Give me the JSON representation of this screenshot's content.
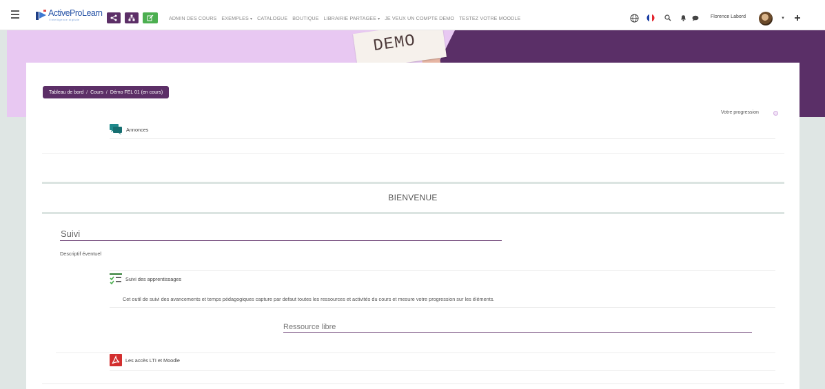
{
  "navbar": {
    "logo_text": "ActiveProLearn",
    "logo_tagline": "l'intelligence digitale",
    "links": [
      {
        "label": "ADMIN DES COURS",
        "dropdown": false
      },
      {
        "label": "EXEMPLES",
        "dropdown": true
      },
      {
        "label": "CATALOGUE",
        "dropdown": false
      },
      {
        "label": "BOUTIQUE",
        "dropdown": false
      },
      {
        "label": "LIBRAIRIE PARTAGEE",
        "dropdown": true
      },
      {
        "label": "JE VEUX UN COMPTE DEMO",
        "dropdown": false
      },
      {
        "label": "TESTEZ VOTRE MOODLE",
        "dropdown": false
      }
    ],
    "user_name": "Florence Labord",
    "quick_buttons": [
      "share-icon",
      "sitemap-icon",
      "edit-icon"
    ],
    "right_icons": [
      "globe-icon",
      "french-flag-icon",
      "search-icon",
      "bell-icon",
      "chat-icon",
      "plus-icon"
    ]
  },
  "banner": {
    "demo_text": "DEMO"
  },
  "breadcrumb": {
    "items": [
      "Tableau de bord",
      "Cours",
      "Démo FEL 01 (en cours)"
    ],
    "separator": "/"
  },
  "progress": {
    "label": "Votre progression"
  },
  "announcements": {
    "label": "Annonces",
    "icon": "forum-icon"
  },
  "section": {
    "title": "BIENVENUE"
  },
  "suivi": {
    "title": "Suivi",
    "description": "Descriptif éventuel",
    "activity_label": "Suivi des apprentissages",
    "activity_icon": "checklist-icon",
    "activity_description": "Cet outil de suivi des avancements et temps pédagogiques capture par defaut toutes les ressources et activités du cours et mesure votre progression sur les éléments."
  },
  "ressource": {
    "title": "Ressource libre",
    "file_label": "Les accès LTI et Moodle",
    "file_icon": "pdf-icon"
  },
  "colors": {
    "brand_purple": "#5c2f67",
    "banner_light": "#e8c8f2",
    "banner_dark": "#5a2f67",
    "green_button": "#4caf50",
    "teal_icon": "#1f8a8c",
    "pdf_red": "#d32f2f"
  }
}
